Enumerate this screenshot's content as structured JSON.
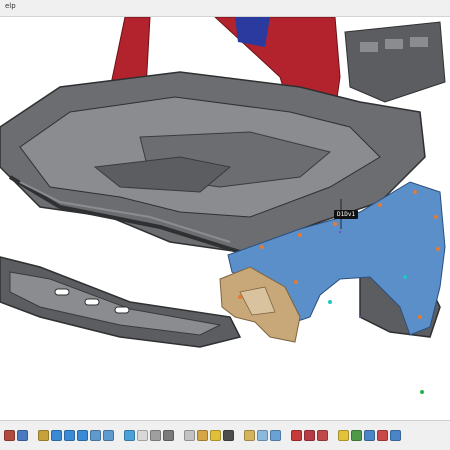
{
  "menubar": {
    "text": "elp"
  },
  "viewport": {
    "tag_label": "D1Dv1"
  },
  "colors": {
    "frame_dark": "#5b5d60",
    "frame_light": "#8a8c8f",
    "body_red": "#b3232e",
    "fender_blue": "#5b8fc9",
    "bracket_tan": "#c8a878",
    "marker_orange": "#e8792e",
    "marker_green": "#25b14a",
    "marker_teal": "#1ec7c2"
  },
  "toolbar": {
    "icons": [
      "pointer-icon",
      "zoom-icon",
      "pan-icon",
      "rotate-icon",
      "zoom-in-icon",
      "zoom-out-icon",
      "fit-all-icon",
      "normal-view-icon",
      "view-multi-icon",
      "shading-icon",
      "hide-show-icon",
      "swap-icon",
      "section-icon",
      "measure-icon",
      "annotation-icon",
      "snapshot-icon",
      "texture-icon",
      "wireframe-icon",
      "clip-icon",
      "lock-icon",
      "analysis-icon",
      "tools-icon",
      "flag-icon",
      "color-icon",
      "settings-icon",
      "grid-icon",
      "help-icon"
    ]
  }
}
